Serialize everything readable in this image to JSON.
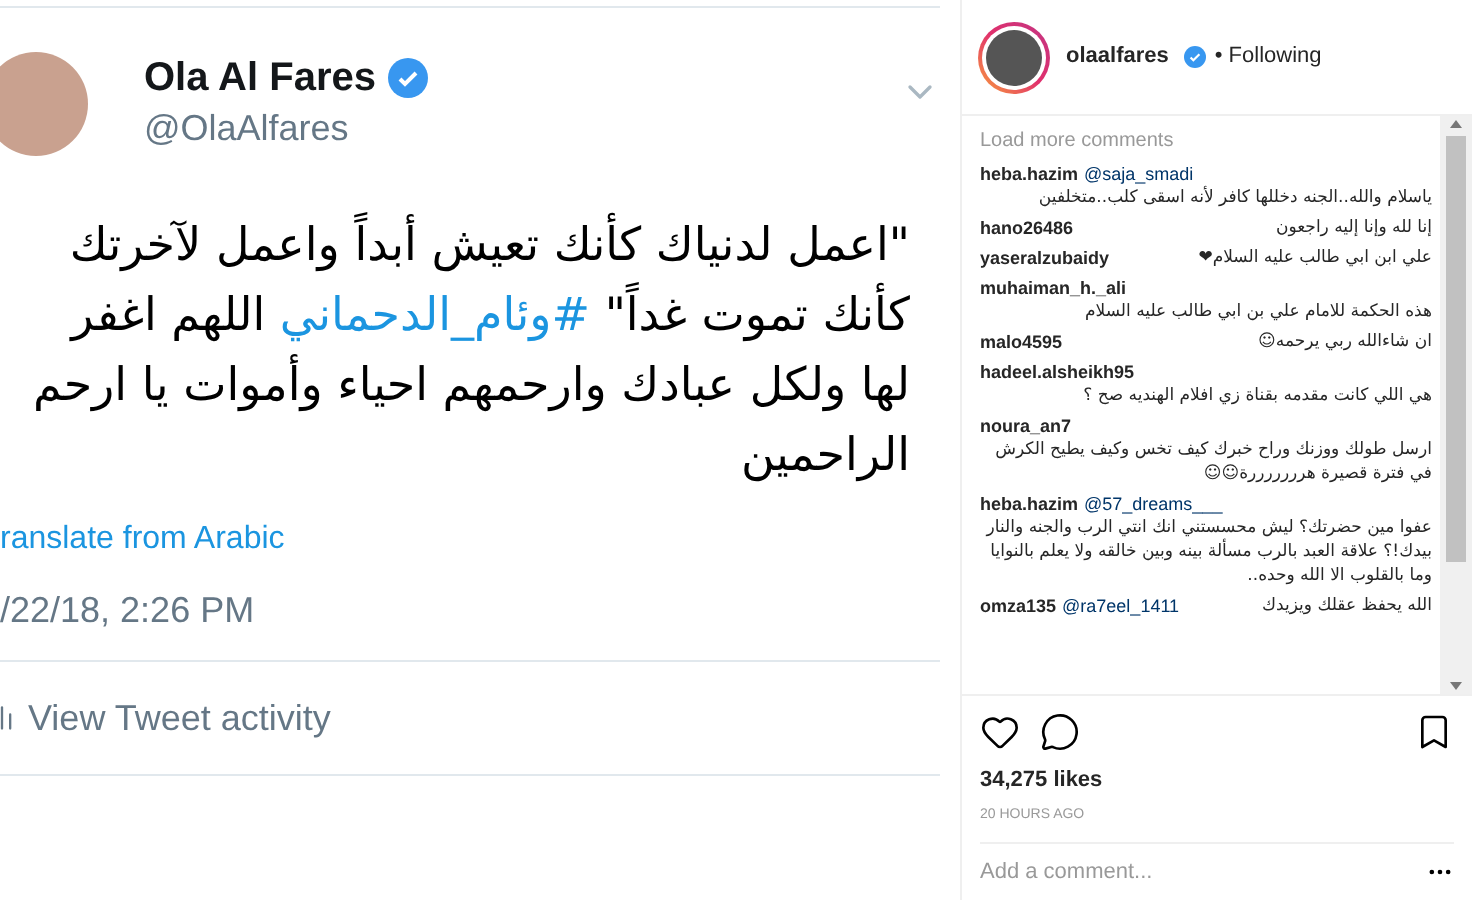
{
  "tweet": {
    "name": "Ola Al Fares",
    "handle": "@OlaAlfares",
    "text_before": "\"اعمل لدنياك كأنك تعيش أبداً واعمل لآخرتك كأنك تموت غداً\"",
    "hashtag": "#وئام_الدحماني",
    "text_after": "اللهم اغفر لها ولكل عبادك وارحمهم احياء وأموات يا ارحم الراحمين",
    "translate": "ranslate from Arabic",
    "timestamp": "/22/18, 2:26 PM",
    "activity": "View Tweet activity"
  },
  "post": {
    "username": "olaalfares",
    "follow": "• Following",
    "load_more": "Load more comments",
    "comments": [
      {
        "user": "heba.hazim",
        "mention": "@saja_smadi",
        "text": "ياسلام والله..الجنه دخللها كافر لأنه اسقى كلب..متخلفين"
      },
      {
        "user": "hano26486",
        "text": "إنا لله وإنا إليه راجعون"
      },
      {
        "user": "yaseralzubaidy",
        "text": "علي ابن ابي طالب عليه السلام❤"
      },
      {
        "user": "muhaiman_h._ali",
        "text": "هذه الحكمة للامام علي بن ابي طالب عليه السلام"
      },
      {
        "user": "malo4595",
        "text": "ان شاءالله ربي يرحمه☺"
      },
      {
        "user": "hadeel.alsheikh95",
        "text": "هي اللي كانت مقدمه بقناة زي افلام الهنديه صح ؟"
      },
      {
        "user": "noura_an7",
        "text": "ارسل طولك ووزنك وراح خبرك كيف تخس وكيف يطيح الكرش في فترة قصيرة هرررررررة☺☺"
      },
      {
        "user": "heba.hazim",
        "mention": "@57_dreams___",
        "text": "عفوا مين حضرتك؟ ليش محسستني انك انتي الرب والجنه والنار بيدك!؟ علاقة العبد بالرب مسألة بينه وبين خالقه ولا يعلم بالنوايا وما بالقلوب الا الله وحده.."
      },
      {
        "user": "omza135",
        "mention": "@ra7eel_1411",
        "text": "الله يحفظ عقلك ويزيدك"
      }
    ],
    "likes": "34,275 likes",
    "time": "20 HOURS AGO",
    "add_comment_placeholder": "Add a comment..."
  }
}
